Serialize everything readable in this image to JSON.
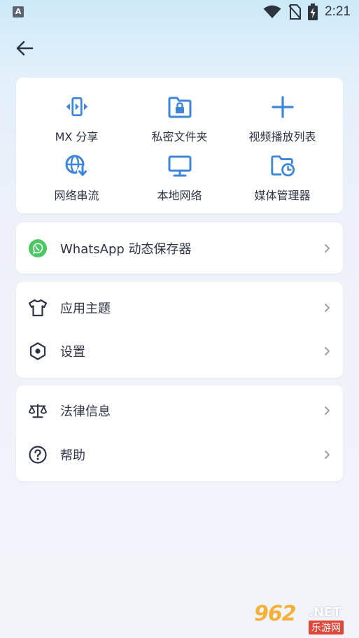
{
  "status_bar": {
    "left_icon": "A",
    "time": "2:21",
    "icons": [
      "wifi-icon",
      "no-sim-icon",
      "battery-charging-icon"
    ]
  },
  "header": {
    "back_icon": "arrow-left-icon"
  },
  "quick_actions": [
    {
      "label": "MX 分享",
      "icon": "mx-share-icon"
    },
    {
      "label": "私密文件夹",
      "icon": "private-folder-icon"
    },
    {
      "label": "视频播放列表",
      "icon": "plus-icon"
    },
    {
      "label": "网络串流",
      "icon": "network-stream-icon"
    },
    {
      "label": "本地网络",
      "icon": "local-network-icon"
    },
    {
      "label": "媒体管理器",
      "icon": "media-manager-icon"
    }
  ],
  "whatsapp_card": {
    "label": "WhatsApp 动态保存器",
    "icon": "whatsapp-icon"
  },
  "app_card": [
    {
      "label": "应用主题",
      "icon": "tshirt-icon"
    },
    {
      "label": "设置",
      "icon": "settings-hex-icon"
    }
  ],
  "info_card": [
    {
      "label": "法律信息",
      "icon": "scales-icon"
    },
    {
      "label": "帮助",
      "icon": "help-circle-icon"
    }
  ],
  "colors": {
    "accent": "#3d85d8",
    "whatsapp": "#4cc764",
    "text": "#2d3446",
    "chevron": "#9aa1ad"
  },
  "watermark": {
    "number": "962",
    "suffix": ".NET",
    "cn": "乐游网"
  }
}
